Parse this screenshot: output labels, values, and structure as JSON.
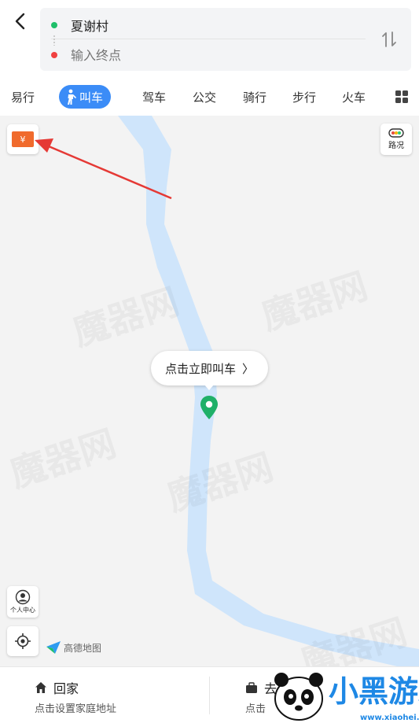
{
  "header": {
    "start_point": "夏谢村",
    "end_placeholder": "输入终点"
  },
  "tabs": [
    {
      "label": "易行",
      "active": false
    },
    {
      "label": "叫车",
      "active": true
    },
    {
      "label": "驾车",
      "active": false
    },
    {
      "label": "公交",
      "active": false
    },
    {
      "label": "骑行",
      "active": false
    },
    {
      "label": "步行",
      "active": false
    },
    {
      "label": "火车",
      "active": false
    }
  ],
  "map": {
    "coupon_symbol": "¥",
    "traffic_label": "路况",
    "personal_center_label": "个人中心",
    "callout_text": "点击立即叫车",
    "callout_chevron": "〉",
    "logo_text": "高德地图",
    "watermark_text": "魔器网"
  },
  "bottom": {
    "home_title": "回家",
    "home_subtitle": "点击设置家庭地址",
    "work_title": "去",
    "work_subtitle": "点击"
  },
  "brand": {
    "name": "小黑游戏",
    "url": "www.xiaohei.com"
  },
  "colors": {
    "accent_blue": "#3b8cf7",
    "start_dot": "#1fbf6a",
    "end_dot": "#f04141",
    "river": "#cfe5fb",
    "arrow": "#e53935",
    "pin": "#1fb068"
  }
}
